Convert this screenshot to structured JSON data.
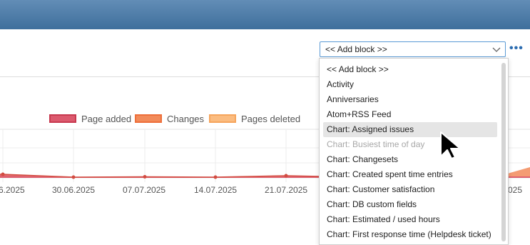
{
  "header": {},
  "legend": [
    {
      "label": "Page added",
      "fill": "#dc5a6e",
      "border": "#c8394f"
    },
    {
      "label": "Changes",
      "fill": "#f28b5a",
      "border": "#ee6f3a"
    },
    {
      "label": "Pages deleted",
      "fill": "#fbbc80",
      "border": "#f6a55c"
    }
  ],
  "x_labels": [
    "6.2025",
    "30.06.2025",
    "07.07.2025",
    "14.07.2025",
    "21.07.2025",
    "025"
  ],
  "add_block": {
    "selected": "<< Add block >>",
    "more_label": "•••"
  },
  "dropdown_options": [
    {
      "label": "<< Add block >>",
      "state": "normal"
    },
    {
      "label": "Activity",
      "state": "normal"
    },
    {
      "label": "Anniversaries",
      "state": "normal"
    },
    {
      "label": "Atom+RSS Feed",
      "state": "normal"
    },
    {
      "label": "Chart: Assigned issues",
      "state": "highlighted"
    },
    {
      "label": "Chart: Busiest time of day",
      "state": "disabled"
    },
    {
      "label": "Chart: Changesets",
      "state": "normal"
    },
    {
      "label": "Chart: Created spent time entries",
      "state": "normal"
    },
    {
      "label": "Chart: Customer satisfaction",
      "state": "normal"
    },
    {
      "label": "Chart: DB custom fields",
      "state": "normal"
    },
    {
      "label": "Chart: Estimated / used hours",
      "state": "normal"
    },
    {
      "label": "Chart: First response time (Helpdesk ticket)",
      "state": "normal"
    }
  ],
  "icons": {
    "select_chevron": "chevron-down-icon",
    "cursor": "mouse-pointer-icon"
  }
}
